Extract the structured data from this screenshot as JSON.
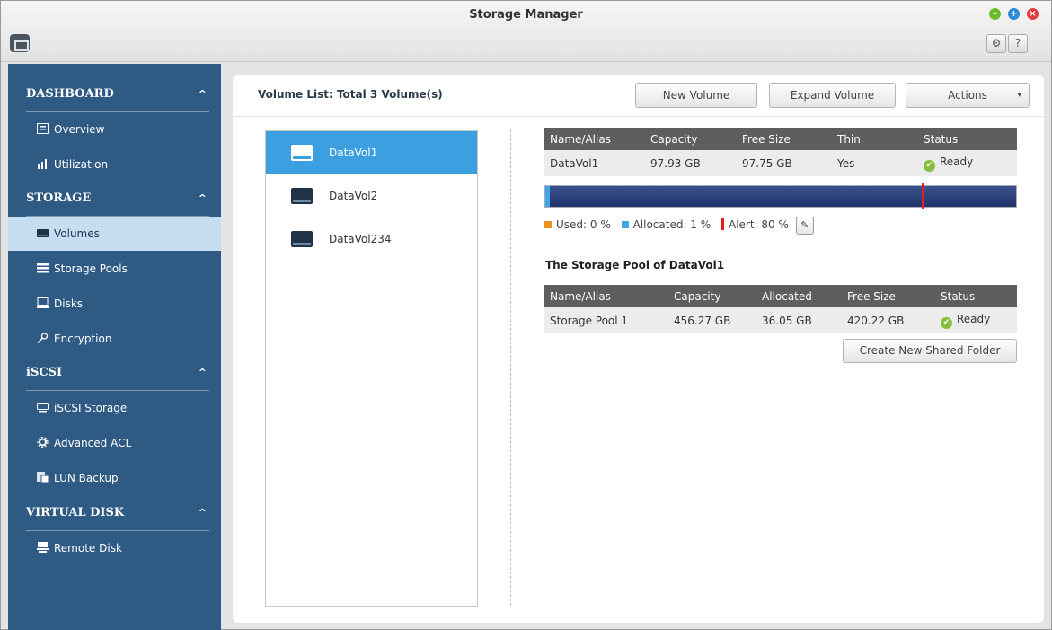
{
  "window": {
    "title": "Storage Manager",
    "controls": {
      "minimize": "–",
      "maximize": "+",
      "close": "×"
    }
  },
  "toolbar": {
    "settings_icon": "⚙",
    "help_label": "?"
  },
  "sidebar": {
    "sections": [
      {
        "title": "DASHBOARD",
        "caret": "^",
        "items": [
          {
            "label": "Overview",
            "icon": "overview-icon"
          },
          {
            "label": "Utilization",
            "icon": "utilization-icon"
          }
        ]
      },
      {
        "title": "STORAGE",
        "caret": "^",
        "items": [
          {
            "label": "Volumes",
            "icon": "volume-icon",
            "active": true
          },
          {
            "label": "Storage Pools",
            "icon": "storage-pools-icon"
          },
          {
            "label": "Disks",
            "icon": "disks-icon"
          },
          {
            "label": "Encryption",
            "icon": "key-icon"
          }
        ]
      },
      {
        "title": "iSCSI",
        "caret": "^",
        "items": [
          {
            "label": "iSCSI Storage",
            "icon": "iscsi-storage-icon"
          },
          {
            "label": "Advanced ACL",
            "icon": "gear-icon"
          },
          {
            "label": "LUN Backup",
            "icon": "lun-backup-icon"
          }
        ]
      },
      {
        "title": "VIRTUAL DISK",
        "caret": "^",
        "items": [
          {
            "label": "Remote Disk",
            "icon": "remote-disk-icon"
          }
        ]
      }
    ]
  },
  "main": {
    "volume_list_title": "Volume List: Total 3 Volume(s)",
    "buttons": {
      "new_volume": "New Volume",
      "expand_volume": "Expand Volume",
      "actions": "Actions",
      "actions_arrow": "▾"
    },
    "volumes": [
      {
        "name": "DataVol1",
        "selected": true
      },
      {
        "name": "DataVol2",
        "selected": false
      },
      {
        "name": "DataVol234",
        "selected": false
      }
    ],
    "volume_table": {
      "headers": [
        "Name/Alias",
        "Capacity",
        "Free Size",
        "Thin",
        "Status"
      ],
      "row": [
        "DataVol1",
        "97.93 GB",
        "97.75 GB",
        "Yes",
        "Ready"
      ]
    },
    "usage_bar": {
      "used_percent": 0,
      "allocated_percent": 1,
      "alert_percent": 80
    },
    "legend": {
      "used": "Used: 0 %",
      "allocated": "Allocated: 1 %",
      "alert": "Alert: 80 %",
      "edit_icon": "✎"
    },
    "pool_title": "The Storage Pool of DataVol1",
    "pool_table": {
      "headers": [
        "Name/Alias",
        "Capacity",
        "Allocated",
        "Free Size",
        "Status"
      ],
      "row": [
        "Storage Pool 1",
        "456.27 GB",
        "36.05 GB",
        "420.22 GB",
        "Ready"
      ]
    },
    "status_check": "✔",
    "create_shared_folder": "Create New Shared Folder"
  },
  "colors": {
    "sidebar_bg": "#2e5a84",
    "sidebar_active": "#c5ddf0",
    "selected_volume": "#3b9fe0",
    "table_header": "#5e5e5e",
    "used": "#f09022",
    "allocated": "#41a6e6",
    "alert": "#e02020",
    "ready": "#84c03e"
  }
}
